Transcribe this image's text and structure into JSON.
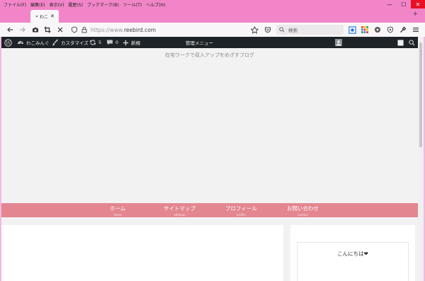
{
  "window": {
    "menu": [
      "ファイル(F)",
      "編集(E)",
      "表示(V)",
      "履歴(S)",
      "ブックマーク(B)",
      "ツール(T)",
      "ヘルプ(H)"
    ],
    "controls": {
      "minimize": "—",
      "maximize": "☐",
      "close": "✕"
    }
  },
  "tab": {
    "title": "わこ",
    "close": "✕",
    "new_tab": "+"
  },
  "navbar": {
    "url_scheme": "https://www.",
    "url_host": "reebird.com",
    "search_placeholder": "検索"
  },
  "adminbar": {
    "site_name": "わこみんぐ",
    "customize": "カスタマイズ",
    "updates": "5",
    "comments": "0",
    "new": "新規",
    "admin_menu": "管理メニュー"
  },
  "site": {
    "tagline": "在宅ワークで収入アップをめざすブログ"
  },
  "gnav": [
    {
      "label": "ホーム",
      "sub": "home"
    },
    {
      "label": "サイトマップ",
      "sub": "sitemap"
    },
    {
      "label": "プロフィール",
      "sub": "profile"
    },
    {
      "label": "お問い合わせ",
      "sub": "contact"
    }
  ],
  "sidebar": {
    "widget_title": "こんにちは❤"
  },
  "colors": {
    "window_accent": "#f285c8",
    "adminbar_bg": "#1d2327",
    "gnav_bg": "#e38690"
  }
}
